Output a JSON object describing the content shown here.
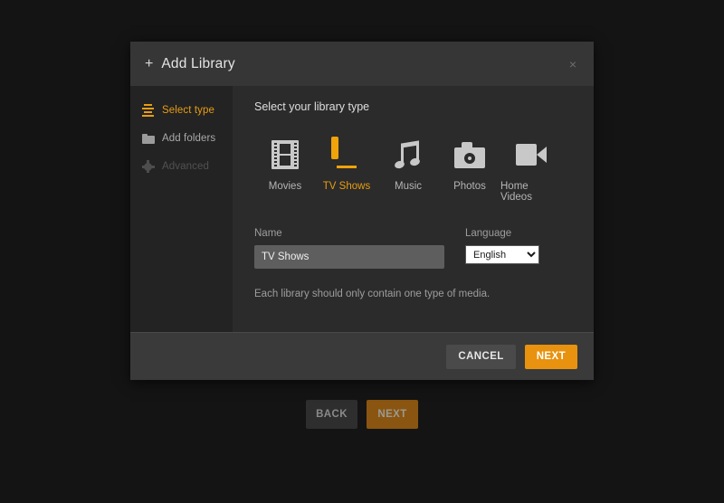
{
  "background_page": {
    "buttons": [
      {
        "label": "BACK",
        "name": "back-button"
      },
      {
        "label": "NEXT",
        "name": "next-button"
      }
    ]
  },
  "modal": {
    "title": "Add Library",
    "plus_glyph": "+",
    "close_glyph": "×",
    "sidebar": {
      "items": [
        {
          "label": "Select type",
          "icon": "stacked-lines-icon",
          "state": "active"
        },
        {
          "label": "Add folders",
          "icon": "folder-icon",
          "state": "normal"
        },
        {
          "label": "Advanced",
          "icon": "gear-icon",
          "state": "disabled"
        }
      ]
    },
    "content": {
      "heading": "Select your library type",
      "library_types": [
        {
          "label": "Movies",
          "icon": "film-strip-icon",
          "selected": false
        },
        {
          "label": "TV Shows",
          "icon": "television-icon",
          "selected": true
        },
        {
          "label": "Music",
          "icon": "music-note-icon",
          "selected": false
        },
        {
          "label": "Photos",
          "icon": "camera-icon",
          "selected": false
        },
        {
          "label": "Home Videos",
          "icon": "camcorder-icon",
          "selected": false
        }
      ],
      "name_field": {
        "label": "Name",
        "value": "TV Shows",
        "placeholder": ""
      },
      "language_field": {
        "label": "Language",
        "value": "English",
        "options": [
          "English"
        ]
      },
      "hint": "Each library should only contain one type of media."
    },
    "footer": {
      "cancel_label": "CANCEL",
      "next_label": "NEXT"
    }
  },
  "colors": {
    "accent": "#e89d12",
    "accent_button": "#e8920f",
    "page_background": "#141414",
    "modal_background": "#2b2b2b",
    "sidebar_background": "#232323",
    "header_background": "#363636",
    "footer_background": "#3a3a3a"
  }
}
